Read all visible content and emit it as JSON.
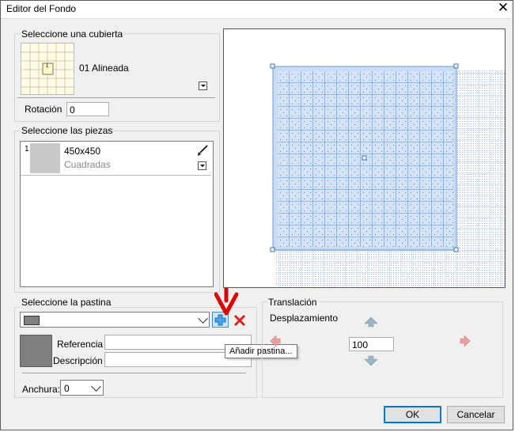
{
  "window": {
    "title": "Editor del Fondo",
    "close_glyph": "✕"
  },
  "cover": {
    "group_label": "Seleccione una cubierta",
    "thumbnail_number": "1",
    "name": "01 Alineada",
    "rotation_label": "Rotación",
    "rotation_value": "0"
  },
  "pieces": {
    "group_label": "Seleccione las piezas",
    "items": [
      {
        "index": "1",
        "size": "450x450",
        "type": "Cuadradas",
        "swatch_color": "#c8c8c8"
      }
    ],
    "brush_icon": "brush-icon"
  },
  "grout": {
    "group_label": "Seleccione la pastina",
    "selected_color": "#808080",
    "swatch_color": "#7f7f7f",
    "reference_label": "Referencia",
    "reference_value": "",
    "description_label": "Descripción",
    "description_value": "",
    "width_label": "Anchura:",
    "width_value": "0",
    "add_icon": "plus-icon",
    "delete_icon": "red-x-icon",
    "tooltip": "Añadir pastina..."
  },
  "translation": {
    "group_label": "Translación",
    "displacement_label": "Desplazamiento",
    "value": "100",
    "arrow_color": "#9bb5c8",
    "left_right_arrow_color": "#e8a0a0"
  },
  "buttons": {
    "ok": "OK",
    "cancel": "Cancelar"
  },
  "annotation": {
    "arrow_color": "#e00000"
  },
  "preview": {
    "tile_fill": "#dce8f8",
    "grid_line": "#5b9be0",
    "selection_fill": "#c9dcf4"
  }
}
